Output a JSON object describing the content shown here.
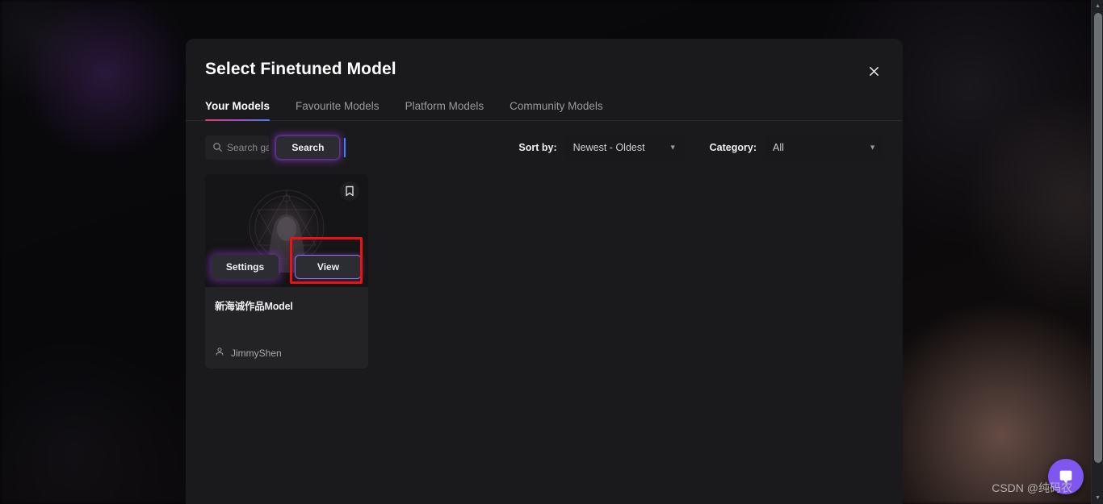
{
  "modal": {
    "title": "Select Finetuned Model",
    "close_icon": "close-icon",
    "tabs": [
      {
        "label": "Your Models",
        "active": true
      },
      {
        "label": "Favourite Models",
        "active": false
      },
      {
        "label": "Platform Models",
        "active": false
      },
      {
        "label": "Community Models",
        "active": false
      }
    ],
    "controls": {
      "search": {
        "icon": "search-icon",
        "placeholder": "Search gallery",
        "value": "",
        "button_label": "Search"
      },
      "sort_by": {
        "label": "Sort by:",
        "value": "Newest - Oldest",
        "chevron": "chevron-down-icon"
      },
      "category": {
        "label": "Category:",
        "value": "All",
        "chevron": "chevron-down-icon"
      }
    },
    "cards": [
      {
        "title": "新海诚作品Model",
        "author": "JimmyShen",
        "bookmark_icon": "bookmark-icon",
        "settings_label": "Settings",
        "view_label": "View"
      }
    ]
  },
  "overlay": {
    "chat_launcher_icon": "chat-bubble-icon",
    "watermark": "CSDN @纯码农"
  },
  "scrollbar": {
    "up_arrow": "▲",
    "down_arrow": "▼"
  },
  "colors": {
    "accent_purple": "#7f56f0",
    "tab_gradient_start": "#e0406f",
    "tab_gradient_end": "#4f7cf2",
    "highlight_red": "#ee1111",
    "modal_bg": "#1a1a1c",
    "card_bg": "#232325"
  }
}
